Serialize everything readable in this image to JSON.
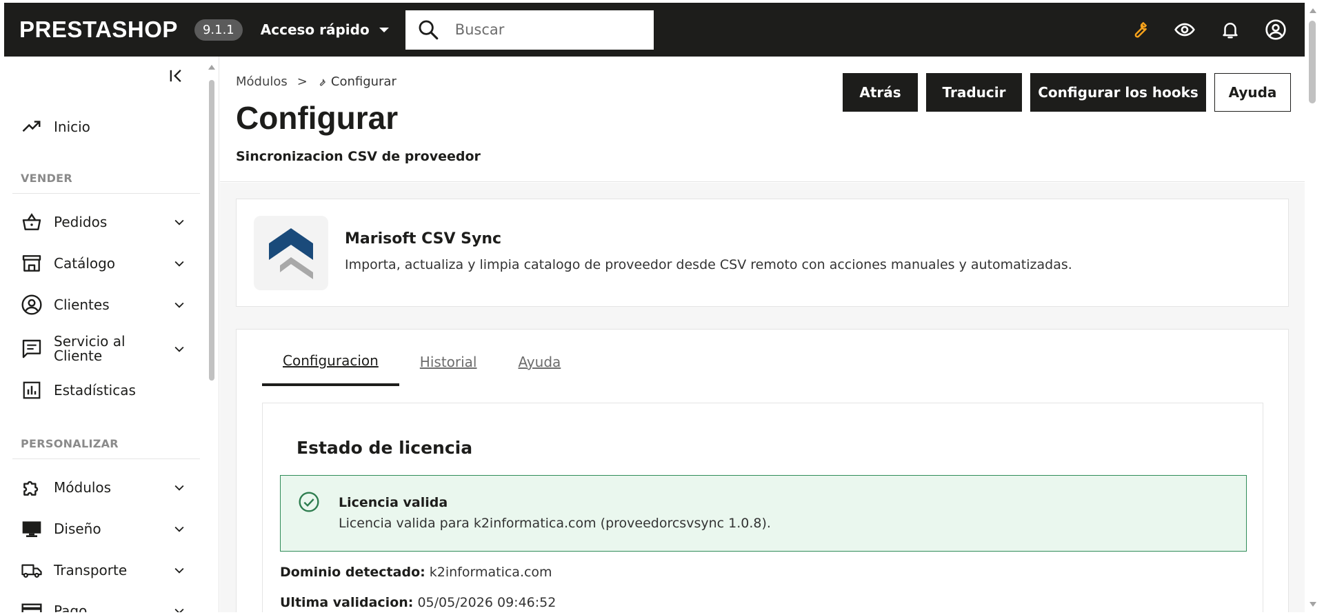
{
  "header": {
    "logo": "PRESTASHOP",
    "version": "9.1.1",
    "quick_access": "Acceso rápido",
    "search_placeholder": "Buscar",
    "icons": [
      "wrench-icon",
      "eye-icon",
      "bell-icon",
      "user-circle-icon"
    ],
    "accent_color": "#f7a21b"
  },
  "sidebar": {
    "home": "Inicio",
    "section_sell": "VENDER",
    "sell_items": [
      {
        "label": "Pedidos",
        "icon": "basket-icon"
      },
      {
        "label": "Catálogo",
        "icon": "store-icon"
      },
      {
        "label": "Clientes",
        "icon": "customer-icon"
      },
      {
        "label": "Servicio al Cliente",
        "icon": "chat-icon"
      },
      {
        "label": "Estadísticas",
        "icon": "stats-icon"
      }
    ],
    "section_customize": "PERSONALIZAR",
    "customize_items": [
      {
        "label": "Módulos",
        "icon": "puzzle-icon"
      },
      {
        "label": "Diseño",
        "icon": "monitor-icon"
      },
      {
        "label": "Transporte",
        "icon": "truck-icon"
      },
      {
        "label": "Pago",
        "icon": "payment-icon"
      }
    ]
  },
  "toolbar": {
    "breadcrumb_parent": "Módulos",
    "breadcrumb_sep": ">",
    "breadcrumb_current": "Configurar",
    "title": "Configurar",
    "subtitle": "Sincronizacion CSV de proveedor",
    "buttons": {
      "back": "Atrás",
      "translate": "Traducir",
      "hooks": "Configurar los hooks",
      "help": "Ayuda"
    }
  },
  "module": {
    "name": "Marisoft CSV Sync",
    "description": "Importa, actualiza y limpia catalogo de proveedor desde CSV remoto con acciones manuales y automatizadas."
  },
  "tabs": {
    "config": "Configuracion",
    "history": "Historial",
    "help": "Ayuda"
  },
  "license": {
    "title": "Estado de licencia",
    "alert_title": "Licencia valida",
    "alert_text": "Licencia valida para k2informatica.com (proveedorcsvsync 1.0.8).",
    "domain_label": "Dominio detectado:",
    "domain_value": "k2informatica.com",
    "validation_label": "Ultima validacion:",
    "validation_value": "05/05/2026 09:46:52"
  }
}
